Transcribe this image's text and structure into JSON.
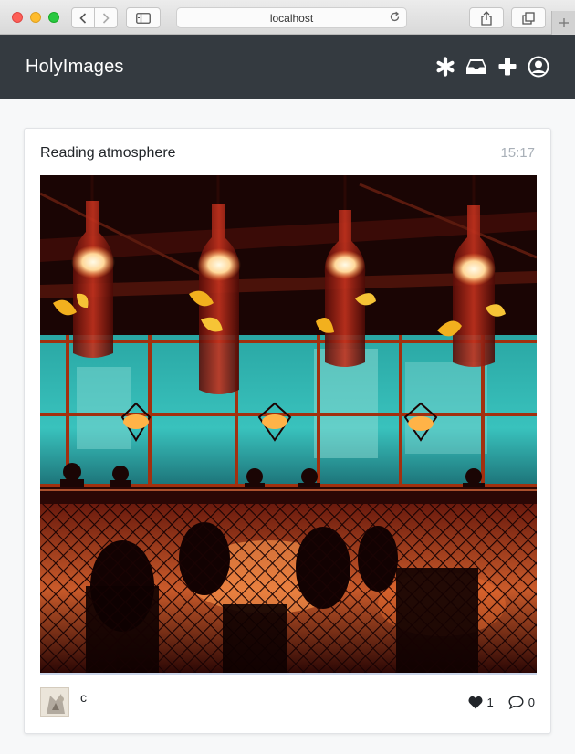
{
  "browser": {
    "address": "localhost"
  },
  "navbar": {
    "brand": "HolyImages",
    "icons": [
      "asterisk-icon",
      "inbox-icon",
      "plus-icon",
      "user-circle-icon"
    ]
  },
  "post": {
    "title": "Reading atmosphere",
    "time": "15:17",
    "author": "c",
    "likes": "1",
    "comments": "0"
  },
  "colors": {
    "navbar_bg": "#343a40",
    "page_bg": "#f7f8f9",
    "time_text": "#a9b0b8"
  }
}
